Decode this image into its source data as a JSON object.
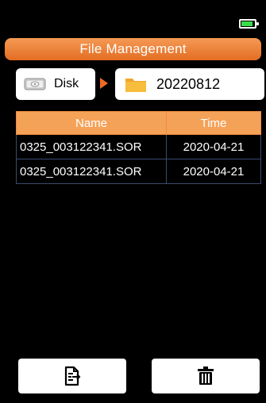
{
  "status": {
    "battery_level": 0.85,
    "battery_color": "#3bdc4a"
  },
  "title": "File Management",
  "breadcrumb": {
    "root": {
      "label": "Disk",
      "icon": "disk-icon"
    },
    "current": {
      "label": "20220812",
      "icon": "folder-icon"
    }
  },
  "table": {
    "headers": {
      "name": "Name",
      "time": "Time"
    },
    "rows": [
      {
        "name": "0325_003122341.SOR",
        "time": "2020-04-21"
      },
      {
        "name": "0325_003122341.SOR",
        "time": "2020-04-21"
      }
    ]
  },
  "actions": {
    "left": {
      "icon": "export-file-icon"
    },
    "right": {
      "icon": "trash-icon"
    }
  },
  "colors": {
    "accent": "#f28a3c",
    "row_border": "#3a4a6f"
  }
}
